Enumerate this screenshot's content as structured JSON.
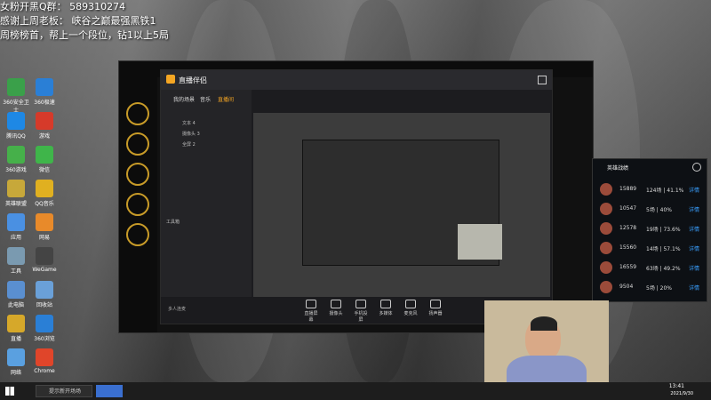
{
  "overlay": {
    "line1": "女粉开黑Q群：  589310274",
    "line2": "感谢上周老板：  峡谷之巅最强黑铁1",
    "line3": "周榜榜首，帮上一个段位，钻1以上5局"
  },
  "desktop_icons": [
    {
      "label": "360安全卫士",
      "icon": "shield-icon",
      "color": "#3aa04a"
    },
    {
      "label": "360极速",
      "icon": "browser-icon",
      "color": "#2a7fd6"
    },
    {
      "label": "腾讯QQ",
      "icon": "qq-icon",
      "color": "#1e88e5"
    },
    {
      "label": "游戏",
      "icon": "game-icon",
      "color": "#d63a2a"
    },
    {
      "label": "360游戏",
      "icon": "plus-icon",
      "color": "#46b04a"
    },
    {
      "label": "微信",
      "icon": "wechat-icon",
      "color": "#3fb54a"
    },
    {
      "label": "英雄联盟",
      "icon": "game-icon",
      "color": "#c7a83a"
    },
    {
      "label": "QQ音乐",
      "icon": "music-icon",
      "color": "#e0b020"
    },
    {
      "label": "应用",
      "icon": "app-icon",
      "color": "#4a90e2"
    },
    {
      "label": "网易",
      "icon": "app-icon",
      "color": "#e88a2a"
    },
    {
      "label": "工具",
      "icon": "tool-icon",
      "color": "#7a9ab0"
    },
    {
      "label": "WeGame",
      "icon": "wegame-icon",
      "color": "#444"
    },
    {
      "label": "此电脑",
      "icon": "computer-icon",
      "color": "#5a8fd0"
    },
    {
      "label": "回收站",
      "icon": "bin-icon",
      "color": "#6aa0d8"
    },
    {
      "label": "直播",
      "icon": "live-icon",
      "color": "#d6a82a"
    },
    {
      "label": "360浏览",
      "icon": "browser-icon",
      "color": "#2a7fd6"
    },
    {
      "label": "网络",
      "icon": "network-icon",
      "color": "#5aa0e0"
    },
    {
      "label": "Chrome",
      "icon": "chrome-icon",
      "color": "#e0452a"
    }
  ],
  "app": {
    "title": "直播伴侣",
    "tabs": [
      "我的场景",
      "音乐",
      "直播间"
    ],
    "scenes": [
      "文本 4",
      "摄像头 3",
      "全屏 2"
    ],
    "tools_title": "工具箱",
    "bottom_tools": [
      "直播屏幕",
      "摄像头",
      "手机投屏",
      "多媒体",
      "麦克风",
      "扬声器"
    ],
    "start_button": "开始直播",
    "status_line": "多人连麦"
  },
  "gift_panel": {
    "title": "英雄战绩",
    "rows": [
      {
        "name": "15889",
        "stat": "124场 | 41.1%",
        "link": "详情"
      },
      {
        "name": "10547",
        "stat": "5场 | 40%",
        "link": "详情"
      },
      {
        "name": "12578",
        "stat": "19场 | 73.6%",
        "link": "详情"
      },
      {
        "name": "15560",
        "stat": "14场 | 57.1%",
        "link": "详情"
      },
      {
        "name": "16559",
        "stat": "63场 | 49.2%",
        "link": "详情"
      },
      {
        "name": "9504",
        "stat": "5场 | 20%",
        "link": "详情"
      }
    ]
  },
  "taskbar": {
    "search": "提示新开场场",
    "time": "13:41",
    "date": "2021/9/30"
  }
}
